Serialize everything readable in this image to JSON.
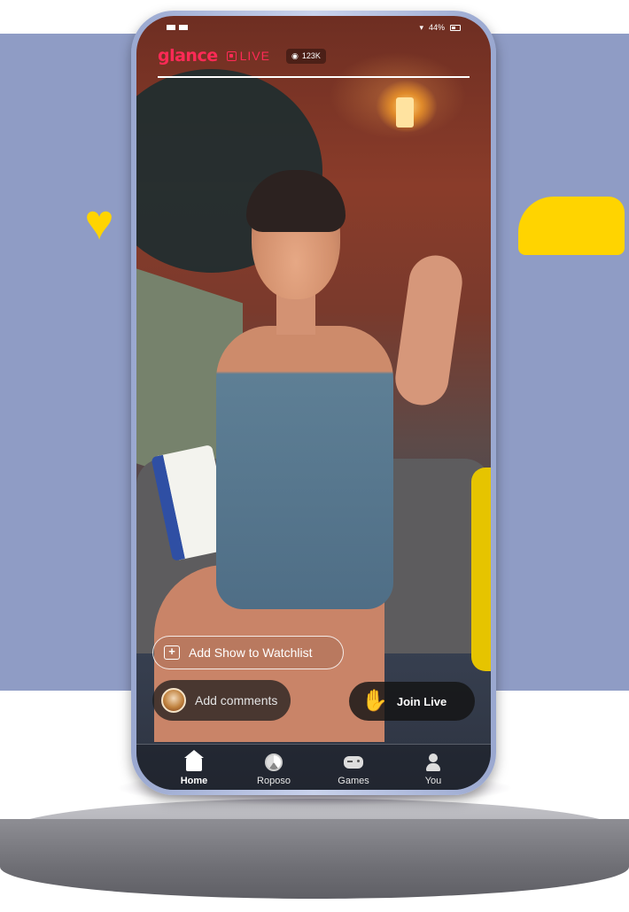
{
  "status_bar": {
    "battery": "44%"
  },
  "header": {
    "brand": "glance",
    "live_label": "LIVE",
    "viewers": "123K",
    "progress_percent": 100
  },
  "actions": {
    "watchlist_label": "Add Show to Watchlist",
    "comment_placeholder": "Add comments",
    "join_label": "Join Live"
  },
  "nav": {
    "items": [
      {
        "label": "Home",
        "icon": "home-icon",
        "active": true
      },
      {
        "label": "Roposo",
        "icon": "roposo-icon",
        "active": false
      },
      {
        "label": "Games",
        "icon": "gamepad-icon",
        "active": false
      },
      {
        "label": "You",
        "icon": "user-icon",
        "active": false
      }
    ]
  },
  "colors": {
    "brand_red": "#ff2a56",
    "backdrop": "#8f9cc5",
    "accent_yellow": "#ffd400"
  }
}
